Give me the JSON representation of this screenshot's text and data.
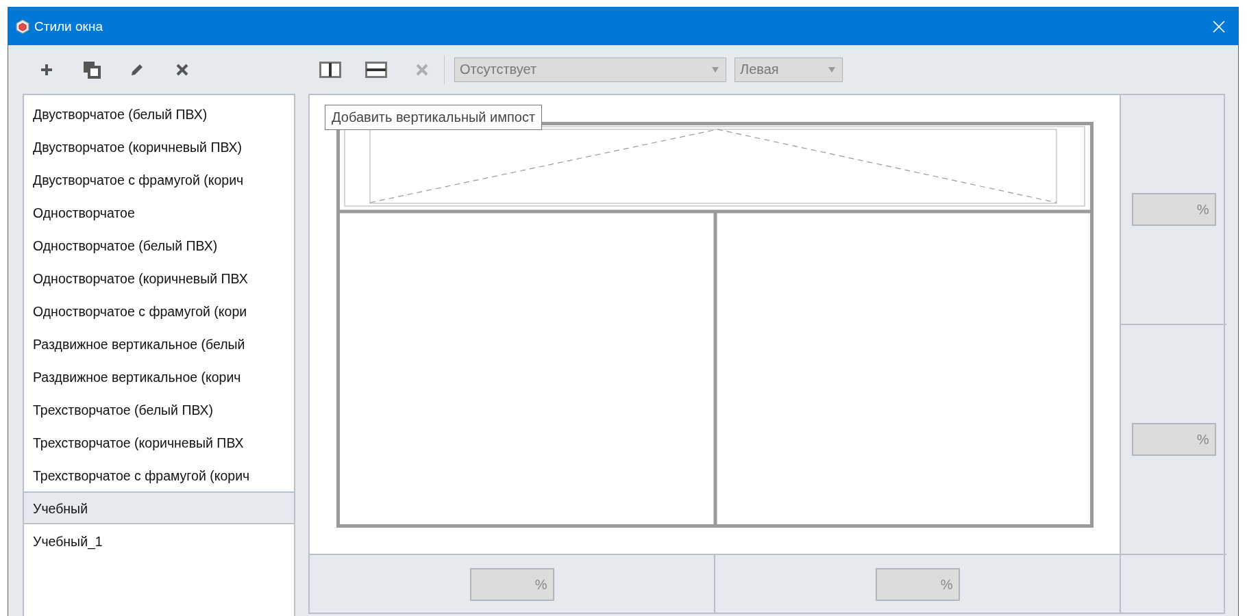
{
  "window": {
    "title": "Стили окна"
  },
  "list_tools": [
    {
      "kind": "add",
      "disabled": false
    },
    {
      "kind": "copy",
      "disabled": false
    },
    {
      "kind": "edit",
      "disabled": false
    },
    {
      "kind": "delete",
      "disabled": false
    }
  ],
  "styles": [
    {
      "label": "Двустворчатое (белый ПВХ)",
      "selected": false
    },
    {
      "label": "Двустворчатое (коричневый ПВХ)",
      "selected": false
    },
    {
      "label": "Двустворчатое с фрамугой (корич",
      "selected": false
    },
    {
      "label": "Одностворчатое",
      "selected": false
    },
    {
      "label": "Одностворчатое (белый ПВХ)",
      "selected": false
    },
    {
      "label": "Одностворчатое (коричневый ПВХ",
      "selected": false
    },
    {
      "label": "Одностворчатое с фрамугой (кори",
      "selected": false
    },
    {
      "label": "Раздвижное вертикальное (белый",
      "selected": false
    },
    {
      "label": "Раздвижное вертикальное (корич",
      "selected": false
    },
    {
      "label": "Трехстворчатое (белый ПВХ)",
      "selected": false
    },
    {
      "label": "Трехстворчатое (коричневый ПВХ",
      "selected": false
    },
    {
      "label": "Трехстворчатое с фрамугой (корич",
      "selected": false
    },
    {
      "label": "Учебный",
      "selected": true
    },
    {
      "label": "Учебный_1",
      "selected": false
    }
  ],
  "editor_tools": [
    {
      "kind": "split-vertical",
      "disabled": false
    },
    {
      "kind": "split-horizontal",
      "disabled": false
    },
    {
      "kind": "delete",
      "disabled": true
    }
  ],
  "fill_dropdown": {
    "value": "Отсутствует"
  },
  "side_dropdown": {
    "value": "Левая"
  },
  "tooltip": {
    "text": "Добавить вертикальный импост"
  },
  "row_sizes": [
    {
      "suffix": "%"
    },
    {
      "suffix": "%"
    }
  ],
  "column_sizes": [
    {
      "suffix": "%"
    },
    {
      "suffix": "%"
    }
  ]
}
